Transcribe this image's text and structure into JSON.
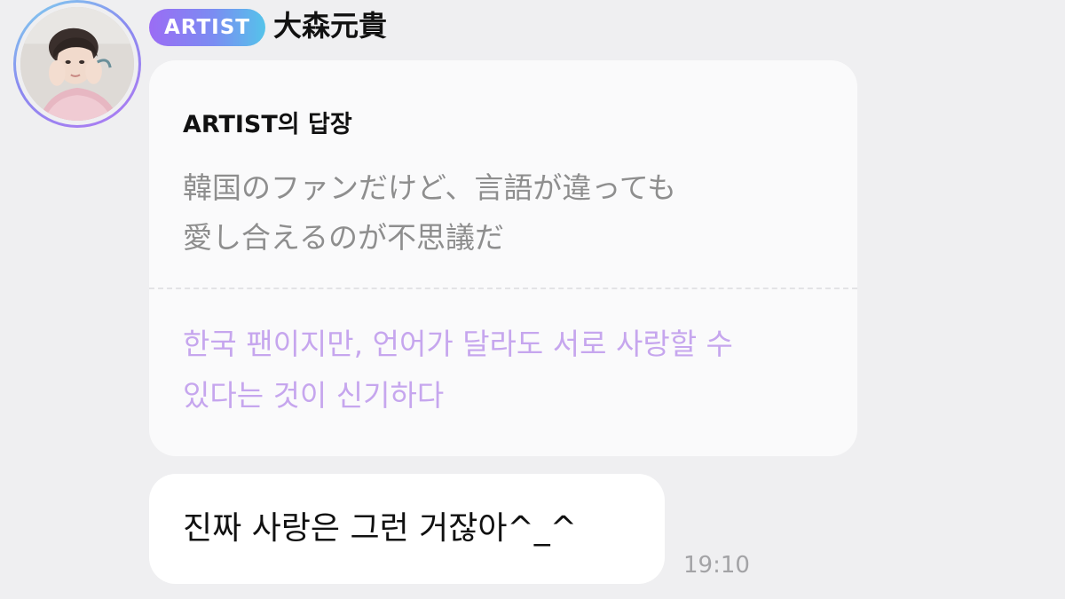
{
  "sender": {
    "badge": "ARTIST",
    "name": "大森元貴"
  },
  "reply": {
    "header": "ARTIST의 답장",
    "original": "韓国のファンだけど、言語が違っても\n愛し合えるのが不思議だ",
    "translation": "한국 팬이지만, 언어가 달라도 서로 사랑할 수\n있다는 것이 신기하다"
  },
  "message": {
    "text": "진짜 사랑은 그런 거잖아^_^",
    "time": "19:10"
  },
  "colors": {
    "background": "#efeff1",
    "badge_gradient": [
      "#9b6cf4",
      "#55c3ea"
    ],
    "translation_text": "#c6a6ee",
    "original_text": "#8e8e8e"
  }
}
